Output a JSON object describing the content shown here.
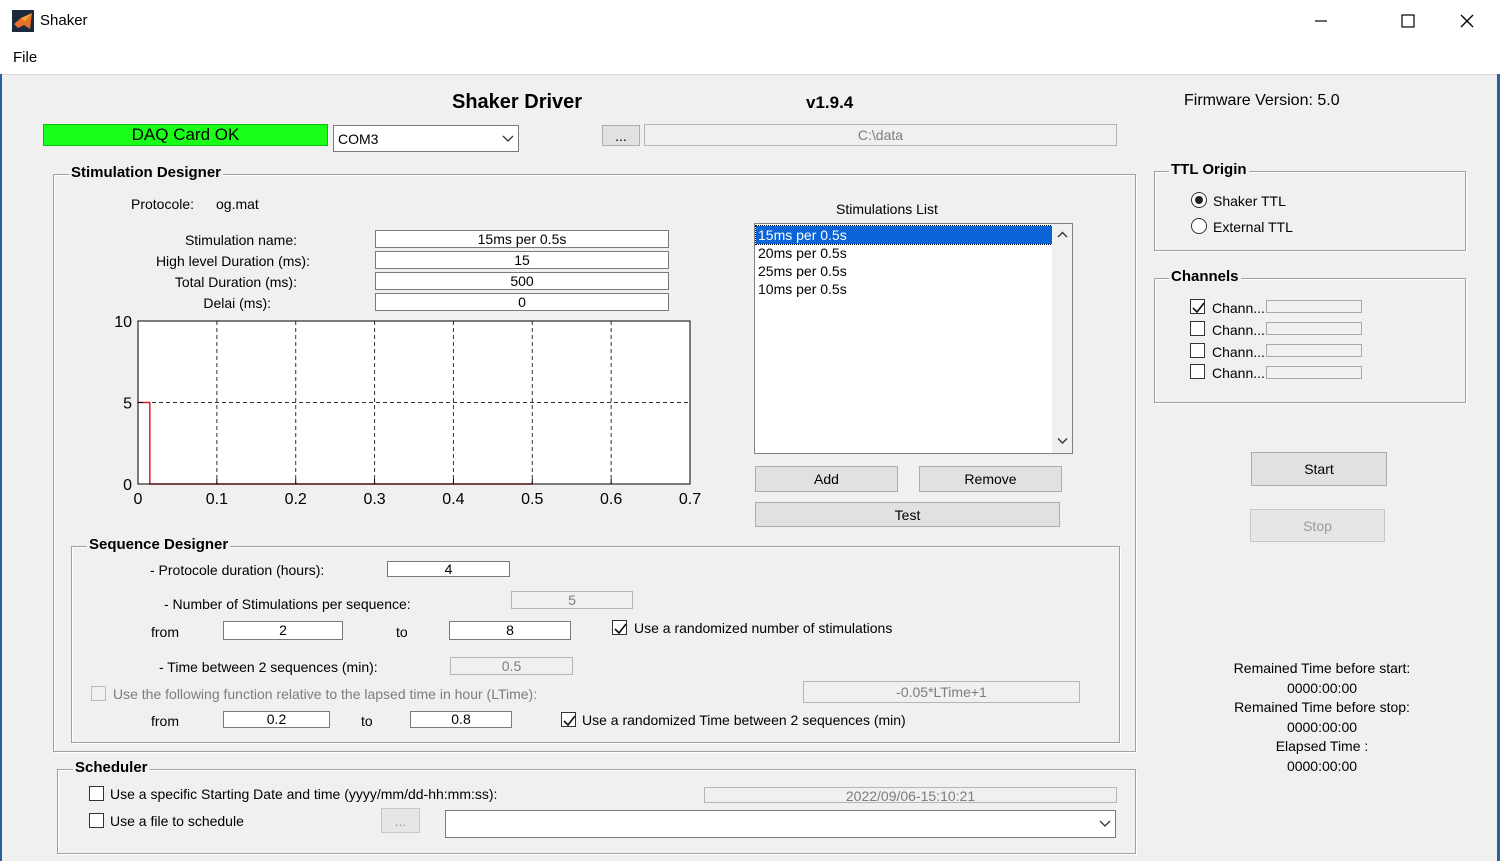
{
  "window": {
    "title": "Shaker"
  },
  "menu": {
    "file": "File"
  },
  "header": {
    "title": "Shaker Driver",
    "version": "v1.9.4",
    "firmware": "Firmware Version: 5.0",
    "daq_status": "DAQ Card OK",
    "port": "COM3",
    "browse_label": "...",
    "data_path": "C:\\data"
  },
  "stim_designer": {
    "title": "Stimulation Designer",
    "protocole_label": "Protocole:",
    "protocole_value": "og.mat",
    "fields": [
      {
        "label": "Stimulation name:",
        "value": "15ms per 0.5s"
      },
      {
        "label": "High level Duration (ms):",
        "value": "15"
      },
      {
        "label": "Total Duration (ms):",
        "value": "500"
      },
      {
        "label": "Delai (ms):",
        "value": "0"
      }
    ],
    "list_title": "Stimulations List",
    "list_items": [
      "15ms per 0.5s",
      "20ms per 0.5s",
      "25ms per 0.5s",
      "10ms per 0.5s"
    ],
    "selected_index": 0,
    "add_label": "Add",
    "remove_label": "Remove",
    "test_label": "Test"
  },
  "chart_data": {
    "type": "line",
    "xlim": [
      0,
      0.7
    ],
    "ylim": [
      0,
      10
    ],
    "x_ticks": [
      "0",
      "0.1",
      "0.2",
      "0.3",
      "0.4",
      "0.5",
      "0.6",
      "0.7"
    ],
    "y_ticks": [
      "0",
      "5",
      "10"
    ],
    "grid": true,
    "series": [
      {
        "color": "#e02020",
        "x": [
          0,
          0.015,
          0.015,
          0.5
        ],
        "y": [
          5,
          5,
          0,
          0
        ]
      }
    ]
  },
  "ttl_origin": {
    "title": "TTL Origin",
    "options": [
      "Shaker TTL",
      "External TTL"
    ],
    "selected_index": 0
  },
  "channels": {
    "title": "Channels",
    "items": [
      {
        "label": "Chann...",
        "checked": true
      },
      {
        "label": "Chann...",
        "checked": false
      },
      {
        "label": "Chann...",
        "checked": false
      },
      {
        "label": "Chann...",
        "checked": false
      }
    ]
  },
  "controls": {
    "start_label": "Start",
    "stop_label": "Stop"
  },
  "timers": {
    "remained_before_start_label": "Remained Time before start:",
    "remained_before_start_value": "0000:00:00",
    "remained_before_stop_label": "Remained Time before stop:",
    "remained_before_stop_value": "0000:00:00",
    "elapsed_label": "Elapsed Time :",
    "elapsed_value": "0000:00:00"
  },
  "sequence": {
    "title": "Sequence Designer",
    "duration_label": "- Protocole duration (hours):",
    "duration_value": "4",
    "num_stim_label": "- Number of Stimulations per sequence:",
    "num_stim_value": "5",
    "from_label": "from",
    "to_label": "to",
    "stim_from": "2",
    "stim_to": "8",
    "randomize_stim_label": "Use a randomized number of stimulations",
    "randomize_stim_checked": true,
    "time_between_label": "- Time between 2 sequences (min):",
    "time_between_value": "0.5",
    "function_label": "Use the following function relative to the lapsed time in hour (LTime):",
    "function_checked": false,
    "function_value": "-0.05*LTime+1",
    "time_from": "0.2",
    "time_to": "0.8",
    "randomize_time_label": "Use a randomized Time between 2 sequences (min)",
    "randomize_time_checked": true
  },
  "scheduler": {
    "title": "Scheduler",
    "start_date_label": "Use a specific Starting Date and time (yyyy/mm/dd-hh:mm:ss):",
    "start_date_checked": false,
    "start_date_value": "2022/09/06-15:10:21",
    "file_label": "Use a file to schedule",
    "file_checked": false,
    "browse_label": "...",
    "file_value": ""
  }
}
